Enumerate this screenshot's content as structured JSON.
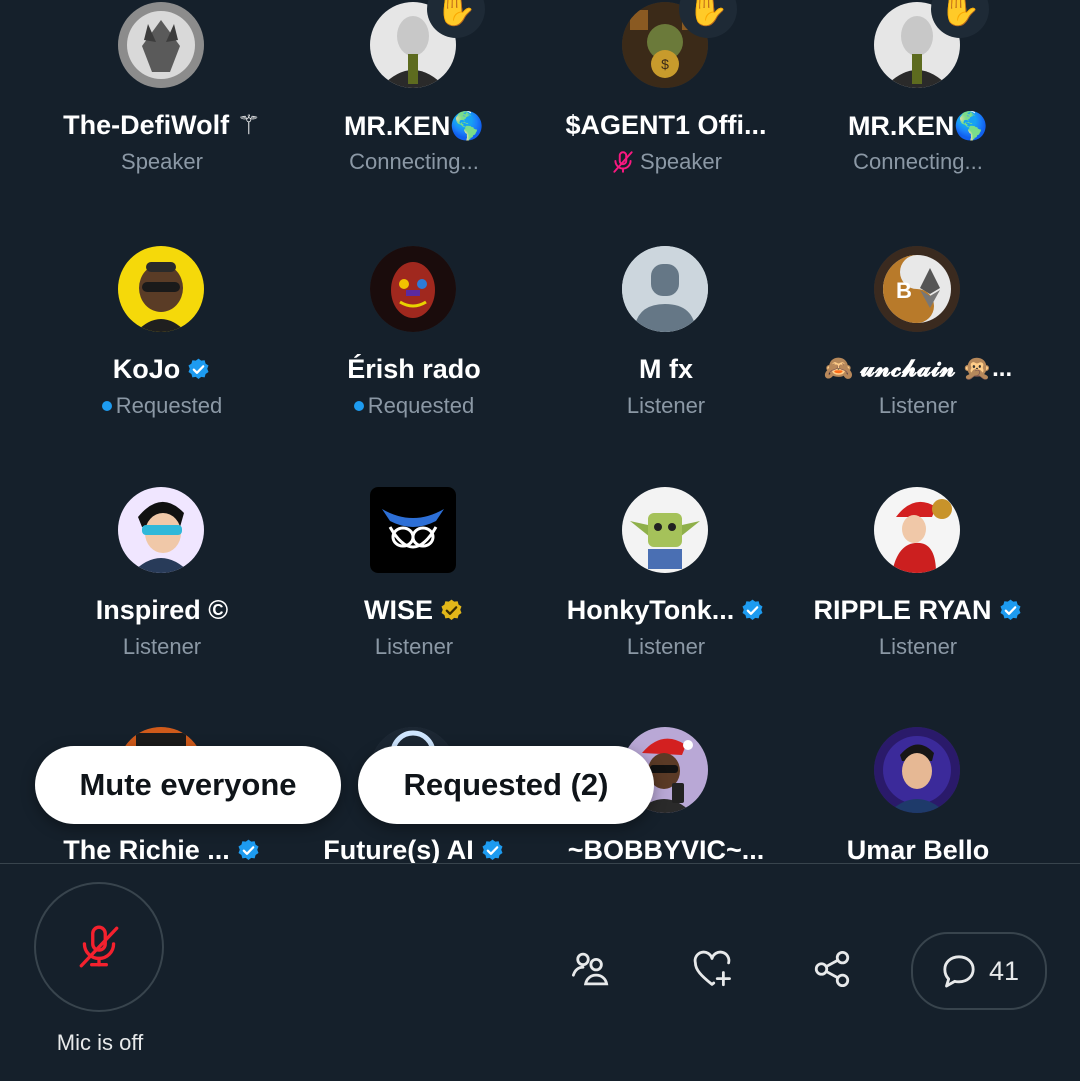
{
  "participants": [
    {
      "name": "The-DefiWolf ⚚",
      "role": "Speaker"
    },
    {
      "name": "MR.KEN🌎",
      "role": "Connecting..."
    },
    {
      "name": "$AGENT1 Offi...",
      "role": "Speaker"
    },
    {
      "name": "MR.KEN🌎",
      "role": "Connecting..."
    },
    {
      "name": "KoJo",
      "role": "Requested"
    },
    {
      "name": "Érish rado",
      "role": "Requested"
    },
    {
      "name": "M fx",
      "role": "Listener"
    },
    {
      "name": "🙈 𝓾𝓷𝓬𝓱𝓪𝓲𝓷 🙊...",
      "role": "Listener"
    },
    {
      "name": "Inspired ©",
      "role": "Listener"
    },
    {
      "name": "WISE",
      "role": "Listener"
    },
    {
      "name": "HonkyTonk...",
      "role": "Listener"
    },
    {
      "name": "RIPPLE RYAN",
      "role": "Listener"
    },
    {
      "name": "The Richie ...",
      "role": ""
    },
    {
      "name": "Future(s) AI",
      "role": ""
    },
    {
      "name": "~BOBBYVIC~...",
      "role": ""
    },
    {
      "name": "Umar Bello",
      "role": ""
    }
  ],
  "actions": {
    "mute_everyone": "Mute everyone",
    "requested": "Requested (2)"
  },
  "controls": {
    "mic_label": "Mic is off",
    "comment_count": "41"
  },
  "icons": {
    "raised_hand": "✋",
    "verified": "verified-badge-icon"
  },
  "colors": {
    "background": "#15202b",
    "verified_blue": "#1d9bf0",
    "verified_gold": "#e2b719",
    "muted_red": "#f4212e",
    "muted_pink": "#f91880"
  }
}
